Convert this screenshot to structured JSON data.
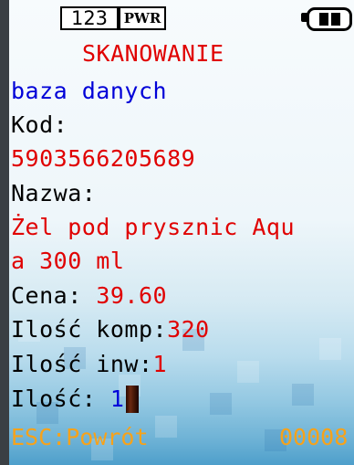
{
  "status_bar": {
    "mode": "123",
    "power": "PWR",
    "battery_icon": "battery-icon"
  },
  "header": {
    "title": "SKANOWANIE"
  },
  "source": "baza danych",
  "fields": {
    "code_label": "Kod:",
    "code_value": "5903566205689",
    "name_label": "Nazwa:",
    "name_value_line1": "Żel pod prysznic Aqu",
    "name_value_line2": "a 300 ml",
    "price_label": "Cena: ",
    "price_value": "39.60",
    "comp_qty_label": "Ilość komp:",
    "comp_qty_value": "320",
    "inv_qty_label": "Ilość inw:",
    "inv_qty_value": "1",
    "qty_label": "Ilość: ",
    "qty_value": "1"
  },
  "footer": {
    "esc_label": "ESC:Powrót",
    "counter": "00008"
  },
  "colors": {
    "accent_red": "#e00000",
    "link_blue": "#0000d8",
    "footer_orange": "#f7a21a"
  }
}
